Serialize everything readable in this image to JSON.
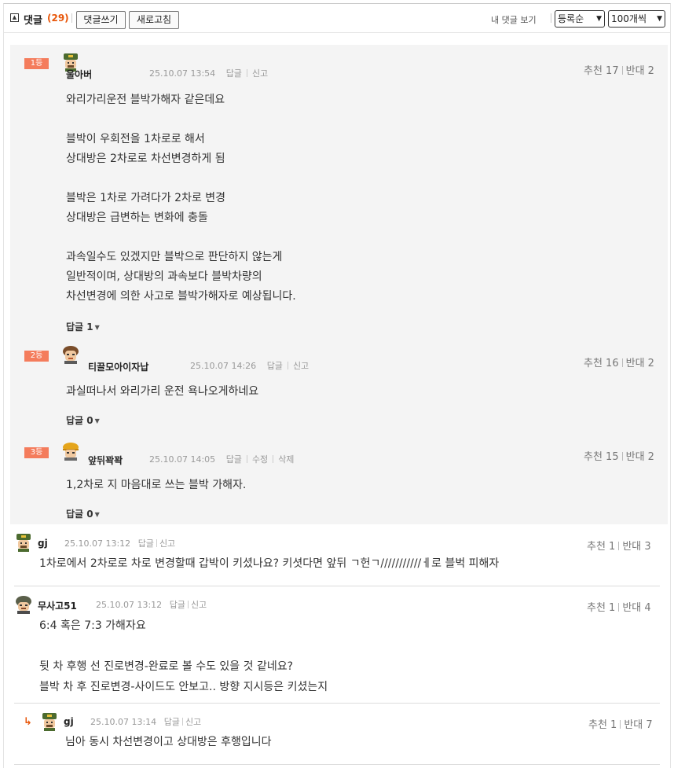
{
  "header": {
    "toggle_icon": "collapse-toggle-icon",
    "title": "댓글",
    "count": "(29)",
    "write_button": "댓글쓰기",
    "refresh_button": "새로고침",
    "my_comments_link": "내 댓글 보기",
    "sort_select": "등록순",
    "per_page_select": "100개씩"
  },
  "best_comments": [
    {
      "rank": "1등",
      "avatar": "soldier-avatar",
      "nickname": "울아버",
      "datetime": "25.10.07 13:54",
      "actions": [
        "답글",
        "신고"
      ],
      "upvote": "추천 17",
      "downvote": "반대 2",
      "lines": [
        "와리가리운전 블박가해자 같은데요",
        "",
        "블박이 우회전을 1차로로 해서",
        "상대방은 2차로로 차선변경하게 됨",
        "",
        "블박은 1차로 가려다가 2차로 변경",
        "상대방은 급변하는 변화에 충돌",
        "",
        "과속일수도 있겠지만 블박으로 판단하지 않는게",
        "일반적이며, 상대방의 과속보다 블박차량의",
        "차선변경에 의한 사고로 블박가해자로 예상됩니다."
      ],
      "reply_count": "답글 1"
    },
    {
      "rank": "2등",
      "avatar": "brown-hair-avatar",
      "nickname": "티끌모아이자납",
      "datetime": "25.10.07 14:26",
      "actions": [
        "답글",
        "신고"
      ],
      "upvote": "추천 16",
      "downvote": "반대 2",
      "lines": [
        "과실떠나서 와리가리 운전 욕나오게하네요"
      ],
      "reply_count": "답글 0"
    },
    {
      "rank": "3등",
      "avatar": "hardhat-avatar",
      "nickname": "앞뒤꽉꽉",
      "datetime": "25.10.07 14:05",
      "actions": [
        "답글",
        "수정",
        "삭제"
      ],
      "upvote": "추천 15",
      "downvote": "반대 2",
      "lines": [
        "1,2차로 지 마음대로 쓰는 블박 가해자."
      ],
      "reply_count": "답글 0"
    }
  ],
  "comments": [
    {
      "avatar": "soldier-avatar",
      "nickname": "gj",
      "datetime": "25.10.07 13:12",
      "actions": [
        "답글",
        "신고"
      ],
      "upvote": "추천 1",
      "downvote": "반대 3",
      "lines": [
        "1차로에서 2차로로 차로 변경할때 갑박이 키셨나요? 키셧다면 앞뒤 ㄱ헌ㄱ///////////ㅔ로 블벅 피해자"
      ]
    },
    {
      "avatar": "helmet-avatar",
      "nickname": "무사고51",
      "datetime": "25.10.07 13:12",
      "actions": [
        "답글",
        "신고"
      ],
      "upvote": "추천 1",
      "downvote": "반대 4",
      "lines": [
        "6:4 혹은 7:3 가해자요",
        "",
        "뒷 차 후행 선 진로변경-완료로 볼 수도 있을 것 같네요?",
        "블박 차 후 진로변경-사이드도 안보고.. 방향 지시등은 키셨는지"
      ]
    },
    {
      "reply_icon": "reply-arrow-icon",
      "reply_glyph": "↳",
      "avatar": "soldier-avatar",
      "nickname": "gj",
      "datetime": "25.10.07 13:14",
      "actions": [
        "답글",
        "신고"
      ],
      "upvote": "추천 1",
      "downvote": "반대 7",
      "lines": [
        "님아 동시 차선변경이고 상대방은 후행입니다"
      ]
    }
  ],
  "colors": {
    "rank_badge": "#f47c5c",
    "accent": "#e8580c",
    "best_bg": "#f4f4f4"
  }
}
